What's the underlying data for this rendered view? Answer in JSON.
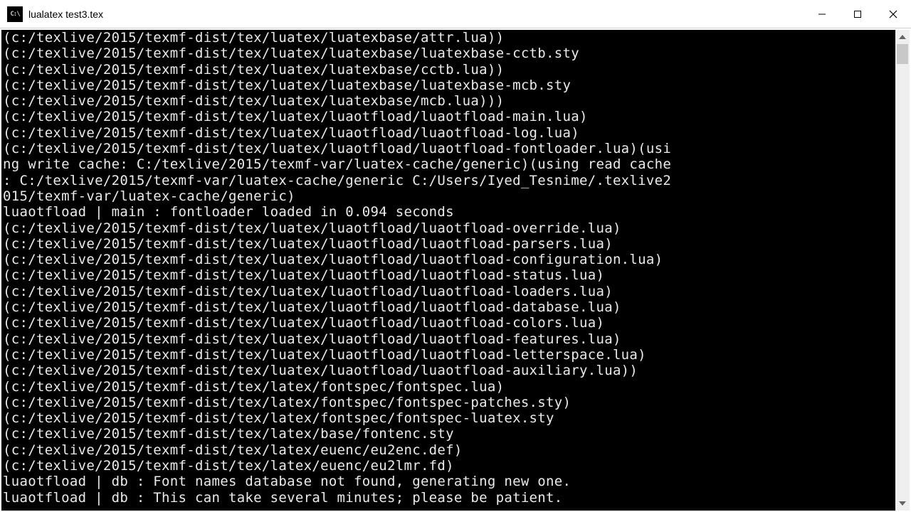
{
  "window": {
    "icon_text": "C:\\",
    "title": "lualatex  test3.tex"
  },
  "console_lines": [
    "(c:/texlive/2015/texmf-dist/tex/luatex/luatexbase/attr.lua))",
    "(c:/texlive/2015/texmf-dist/tex/luatex/luatexbase/luatexbase-cctb.sty",
    "(c:/texlive/2015/texmf-dist/tex/luatex/luatexbase/cctb.lua))",
    "(c:/texlive/2015/texmf-dist/tex/luatex/luatexbase/luatexbase-mcb.sty",
    "(c:/texlive/2015/texmf-dist/tex/luatex/luatexbase/mcb.lua)))",
    "(c:/texlive/2015/texmf-dist/tex/luatex/luaotfload/luaotfload-main.lua)",
    "(c:/texlive/2015/texmf-dist/tex/luatex/luaotfload/luaotfload-log.lua)",
    "(c:/texlive/2015/texmf-dist/tex/luatex/luaotfload/luaotfload-fontloader.lua)(usi",
    "ng write cache: C:/texlive/2015/texmf-var/luatex-cache/generic)(using read cache",
    ": C:/texlive/2015/texmf-var/luatex-cache/generic C:/Users/Iyed_Tesnime/.texlive2",
    "015/texmf-var/luatex-cache/generic)",
    "luaotfload | main : fontloader loaded in 0.094 seconds",
    "(c:/texlive/2015/texmf-dist/tex/luatex/luaotfload/luaotfload-override.lua)",
    "(c:/texlive/2015/texmf-dist/tex/luatex/luaotfload/luaotfload-parsers.lua)",
    "(c:/texlive/2015/texmf-dist/tex/luatex/luaotfload/luaotfload-configuration.lua)",
    "(c:/texlive/2015/texmf-dist/tex/luatex/luaotfload/luaotfload-status.lua)",
    "(c:/texlive/2015/texmf-dist/tex/luatex/luaotfload/luaotfload-loaders.lua)",
    "(c:/texlive/2015/texmf-dist/tex/luatex/luaotfload/luaotfload-database.lua)",
    "(c:/texlive/2015/texmf-dist/tex/luatex/luaotfload/luaotfload-colors.lua)",
    "(c:/texlive/2015/texmf-dist/tex/luatex/luaotfload/luaotfload-features.lua)",
    "(c:/texlive/2015/texmf-dist/tex/luatex/luaotfload/luaotfload-letterspace.lua)",
    "(c:/texlive/2015/texmf-dist/tex/luatex/luaotfload/luaotfload-auxiliary.lua))",
    "(c:/texlive/2015/texmf-dist/tex/latex/fontspec/fontspec.lua)",
    "(c:/texlive/2015/texmf-dist/tex/latex/fontspec/fontspec-patches.sty)",
    "(c:/texlive/2015/texmf-dist/tex/latex/fontspec/fontspec-luatex.sty",
    "(c:/texlive/2015/texmf-dist/tex/latex/base/fontenc.sty",
    "(c:/texlive/2015/texmf-dist/tex/latex/euenc/eu2enc.def)",
    "(c:/texlive/2015/texmf-dist/tex/latex/euenc/eu2lmr.fd)",
    "luaotfload | db : Font names database not found, generating new one.",
    "luaotfload | db : This can take several minutes; please be patient."
  ]
}
